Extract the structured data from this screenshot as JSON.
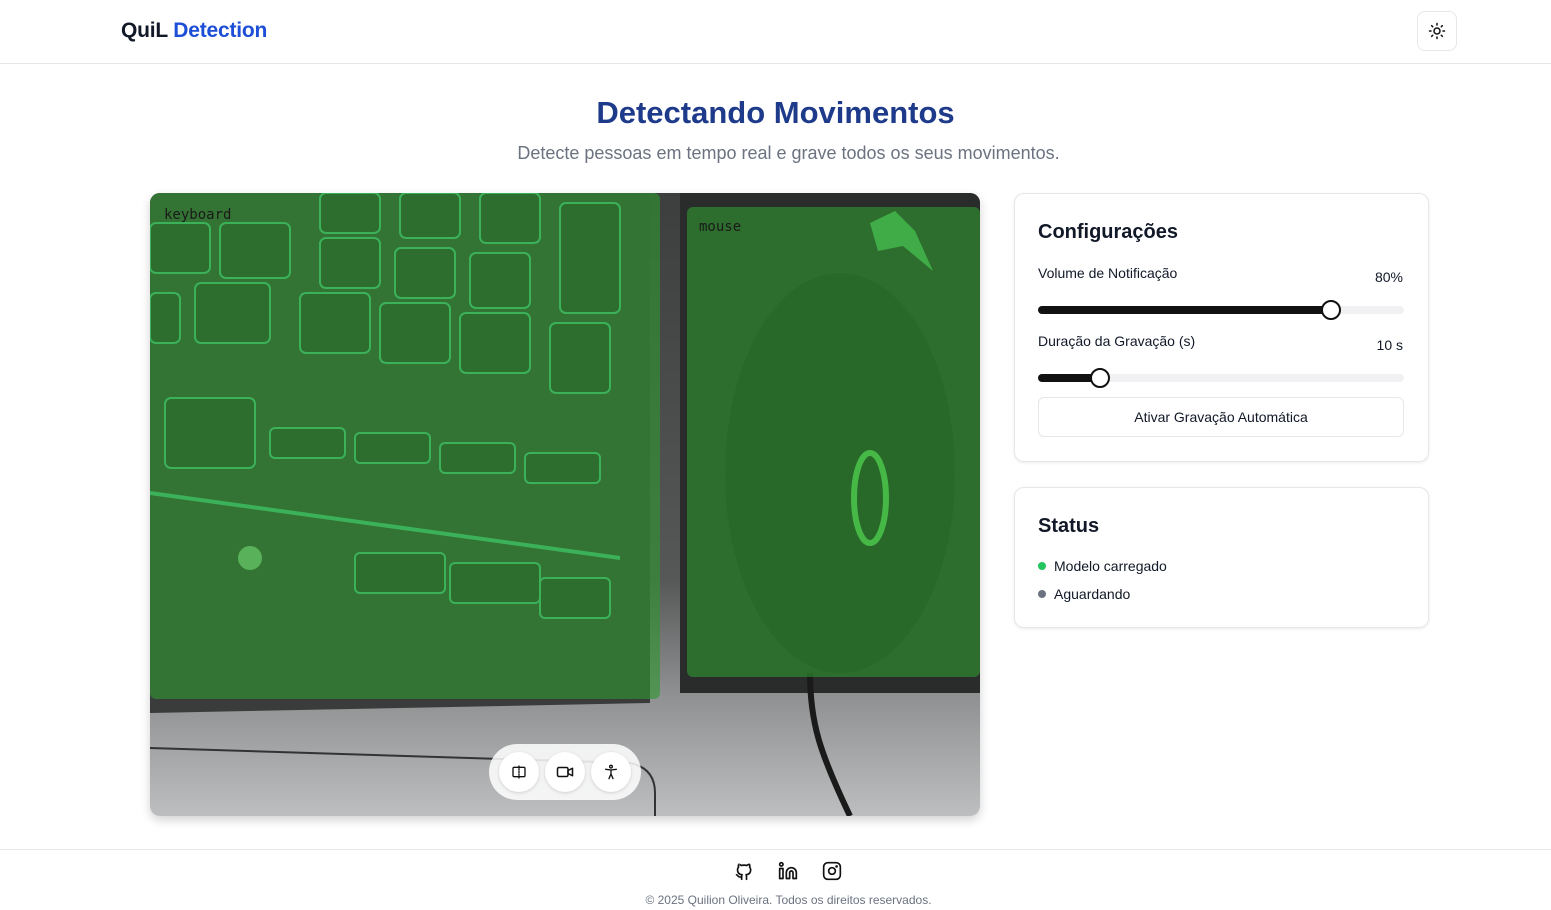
{
  "header": {
    "brand_part1": "QuiL",
    "brand_part2": "Detection",
    "theme_toggle_icon": "sun-icon"
  },
  "hero": {
    "title": "Detectando Movimentos",
    "subtitle": "Detecte pessoas em tempo real e grave todos os seus movimentos."
  },
  "video": {
    "detections": [
      {
        "label": "keyboard"
      },
      {
        "label": "mouse"
      }
    ],
    "detection_color": "#2e962e",
    "controls": [
      {
        "name": "mirror-icon"
      },
      {
        "name": "video-camera-icon"
      },
      {
        "name": "person-icon"
      }
    ]
  },
  "config": {
    "title": "Configurações",
    "volume_label": "Volume de Notificação",
    "volume_value_text": "80%",
    "volume_level": 0.8,
    "duration_label": "Duração da Gravação (s)",
    "duration_value_text": "10 s",
    "duration_level": 0.17,
    "auto_record_button": "Ativar Gravação Automática"
  },
  "status": {
    "title": "Status",
    "items": [
      {
        "text": "Modelo carregado",
        "color": "#22c55e"
      },
      {
        "text": "Aguardando",
        "color": "#6b7280"
      }
    ]
  },
  "footer": {
    "social": [
      "github-icon",
      "linkedin-icon",
      "instagram-icon"
    ],
    "copyright": "© 2025 Quilion Oliveira. Todos os direitos reservados."
  }
}
